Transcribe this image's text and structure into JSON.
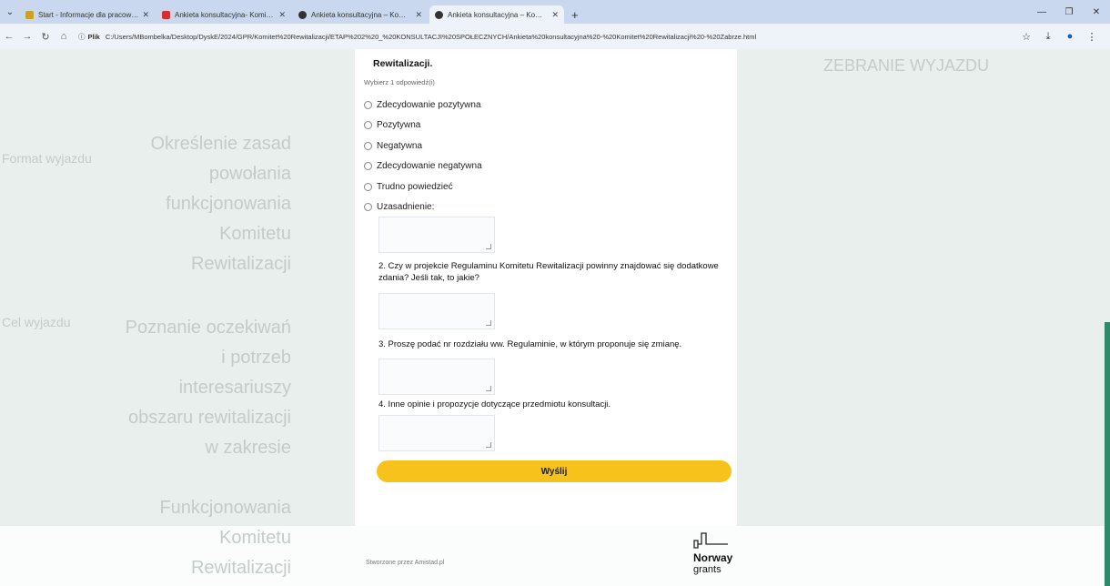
{
  "browser": {
    "tabs": [
      {
        "title": "Start - Informacje dla pracowników",
        "favicon_color": "#c9a227",
        "active": false
      },
      {
        "title": "Ankieta konsultacyjna- Komitet Rewitalizacji",
        "favicon_color": "#d32f2f",
        "active": false
      },
      {
        "title": "Ankieta konsultacyjna – Komitet Rewitalizacji",
        "favicon_color": "#333333",
        "active": false
      },
      {
        "title": "Ankieta konsultacyjna – Komitet Rewitalizacji",
        "favicon_color": "#333333",
        "active": true
      }
    ],
    "address": {
      "scheme_label": "Plik",
      "url": "C:/Users/MBombelka/Desktop/DyskE/2024/GPR/Komitet%20Rewitalizacji/ETAP%202%20_%20KONSULTACJI%20SPOŁECZNYCH/Ankieta%20konsultacyjna%20-%20Komitet%20Rewitalizacji%20-%20Zabrze.html"
    }
  },
  "background": {
    "left_labels": [
      "Format wyjazdu",
      "Cel wyjazdu"
    ],
    "top_heading": "ZEBRANIE WYJAZDU",
    "right_blocks": [
      [
        "Określenie zasad",
        "powołania",
        "funkcjonowania",
        "Komitetu",
        "Rewitalizacji"
      ],
      [
        "Poznanie oczekiwań",
        "i potrzeb",
        "interesariuszy",
        "obszaru rewitalizacji",
        "w zakresie"
      ],
      [
        "Funkcjonowania",
        "Komitetu",
        "Rewitalizacji"
      ]
    ]
  },
  "form": {
    "q1_title_tail": "Rewitalizacji.",
    "hint": "Wybierz 1 odpowiedź(i)",
    "q1_options": [
      "Zdecydowanie pozytywna",
      "Pozytywna",
      "Negatywna",
      "Zdecydowanie negatywna",
      "Trudno powiedzieć",
      "Uzasadnienie:"
    ],
    "q2": "2. Czy w projekcie Regulaminu Komitetu Rewitalizacji powinny znajdować się dodatkowe zdania? Jeśli tak, to jakie?",
    "q3": "3. Proszę podać nr rozdziału ww. Regulaminie, w którym proponuje się zmianę.",
    "q4": "4. Inne opinie i propozycje dotyczące przedmiotu konsultacji.",
    "submit_label": "Wyślij"
  },
  "footer": {
    "credit": "Stworzone przez Amistad.pl",
    "logo_name": "Norway",
    "logo_sub": "grants"
  },
  "colors": {
    "accent_yellow": "#f6c21b",
    "scroll_green": "#2e8a6b"
  }
}
